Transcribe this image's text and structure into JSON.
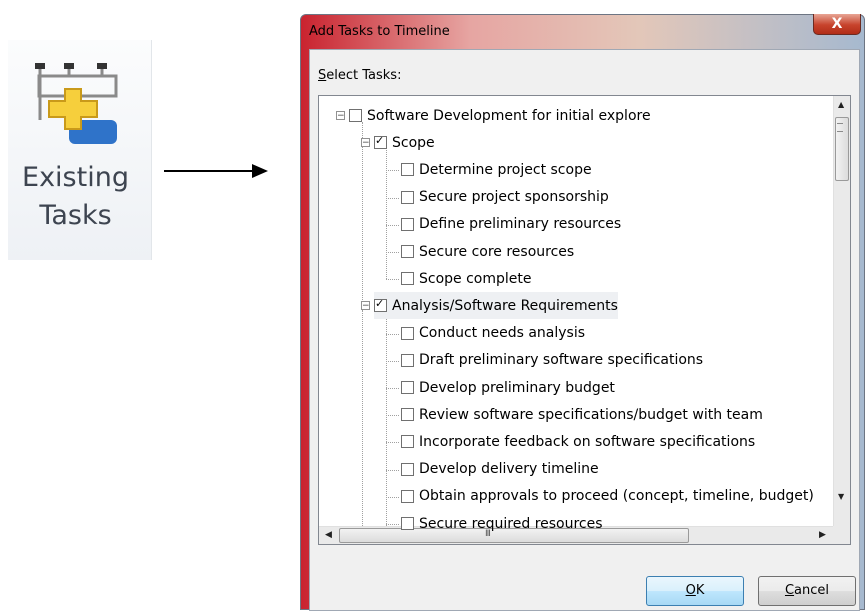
{
  "ribbon": {
    "button_line1": "Existing",
    "button_line2": "Tasks",
    "icon": "existing-tasks-icon"
  },
  "dialog": {
    "title": "Add Tasks to Timeline",
    "close_glyph": "X",
    "select_label_underlined": "S",
    "select_label_rest": "elect Tasks:",
    "ok_underlined": "O",
    "ok_rest": "K",
    "cancel_underlined": "C",
    "cancel_rest": "ancel"
  },
  "tree": {
    "items": [
      {
        "label": "Software Development for initial explore",
        "level": 0,
        "checked": false,
        "expander": "minus"
      },
      {
        "label": "Scope",
        "level": 1,
        "checked": true,
        "expander": "minus"
      },
      {
        "label": "Determine project scope",
        "level": 2,
        "checked": false
      },
      {
        "label": "Secure project sponsorship",
        "level": 2,
        "checked": false
      },
      {
        "label": "Define preliminary resources",
        "level": 2,
        "checked": false
      },
      {
        "label": "Secure core resources",
        "level": 2,
        "checked": false
      },
      {
        "label": "Scope complete",
        "level": 2,
        "checked": false
      },
      {
        "label": "Analysis/Software Requirements",
        "level": 1,
        "checked": true,
        "expander": "minus"
      },
      {
        "label": "Conduct needs analysis",
        "level": 2,
        "checked": false
      },
      {
        "label": "Draft preliminary software specifications",
        "level": 2,
        "checked": false
      },
      {
        "label": "Develop preliminary budget",
        "level": 2,
        "checked": false
      },
      {
        "label": "Review software specifications/budget with team",
        "level": 2,
        "checked": false
      },
      {
        "label": "Incorporate feedback on software specifications",
        "level": 2,
        "checked": false
      },
      {
        "label": "Develop delivery timeline",
        "level": 2,
        "checked": false
      },
      {
        "label": "Obtain approvals to proceed (concept, timeline, budget)",
        "level": 2,
        "checked": false
      },
      {
        "label": "Secure required resources",
        "level": 2,
        "checked": false
      }
    ]
  },
  "scroll": {
    "grip_glyph": "III"
  },
  "colors": {
    "ok_button_border": "#3c7fb1",
    "close_button": "#c7432c"
  }
}
